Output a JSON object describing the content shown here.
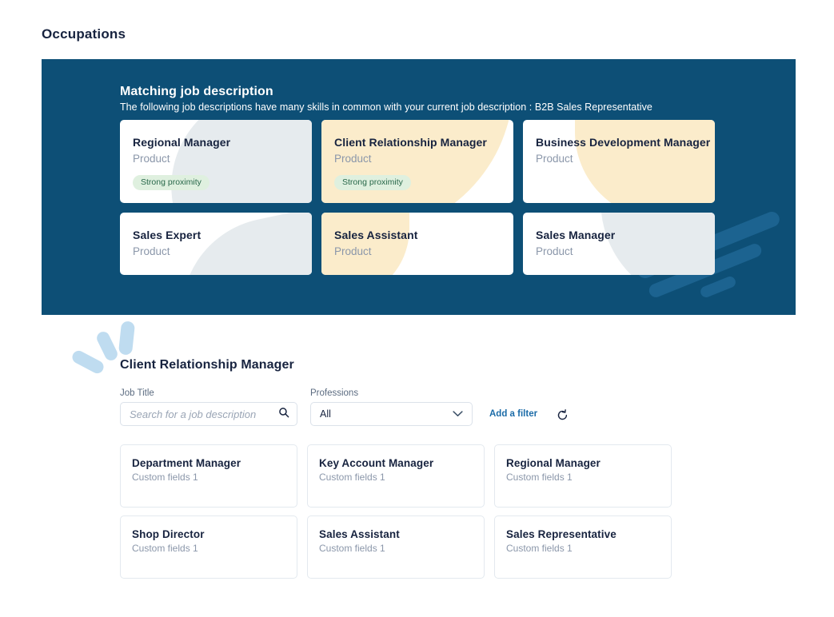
{
  "page": {
    "title": "Occupations"
  },
  "banner": {
    "title": "Matching job description",
    "subtitle": "The following job descriptions have many skills in common with your current job description : B2B Sales Representative",
    "background_color": "#0d4f76",
    "cards": [
      {
        "name": "Regional Manager",
        "subtitle": "Product",
        "badge": "Strong proximity",
        "decor": "gray-a"
      },
      {
        "name": "Client Relationship Manager",
        "subtitle": "Product",
        "badge": "Strong proximity",
        "decor": "yellow-a"
      },
      {
        "name": "Business Development Manager",
        "subtitle": "Product",
        "badge": "",
        "decor": "yellow-b"
      },
      {
        "name": "Sales Expert",
        "subtitle": "Product",
        "badge": "",
        "decor": "gray-b"
      },
      {
        "name": "Sales Assistant",
        "subtitle": "Product",
        "badge": "",
        "decor": "yellow-c"
      },
      {
        "name": "Sales Manager",
        "subtitle": "Product",
        "badge": "",
        "decor": "gray-c"
      }
    ]
  },
  "results": {
    "section_title": "Client Relationship Manager",
    "filters": {
      "job_title_label": "Job Title",
      "search_placeholder": "Search for a job description",
      "search_value": "",
      "search_icon": "search-icon",
      "professions_label": "Professions",
      "professions_value": "All",
      "professions_icon": "chevron-down-icon",
      "add_filter_label": "Add a filter",
      "reset_icon": "reset-arrow-icon"
    },
    "cards": [
      {
        "name": "Department Manager",
        "subtitle": "Custom fields 1"
      },
      {
        "name": "Key Account Manager",
        "subtitle": "Custom fields 1"
      },
      {
        "name": "Regional Manager",
        "subtitle": "Custom fields 1"
      },
      {
        "name": "Shop Director",
        "subtitle": "Custom fields 1"
      },
      {
        "name": "Sales Assistant",
        "subtitle": "Custom fields 1"
      },
      {
        "name": "Sales Representative",
        "subtitle": "Custom fields 1"
      }
    ]
  },
  "theme": {
    "banner_bg": "#0d4f76",
    "accent_blue": "#1c6ca8",
    "badge_bg": "#dff0df",
    "badge_text": "#276749",
    "blob_gray": "#e6ebee",
    "blob_yellow": "#fbeccb",
    "petal_blue": "#bfdcf0",
    "text_dark": "#17233f",
    "text_muted": "#8b97aa"
  }
}
